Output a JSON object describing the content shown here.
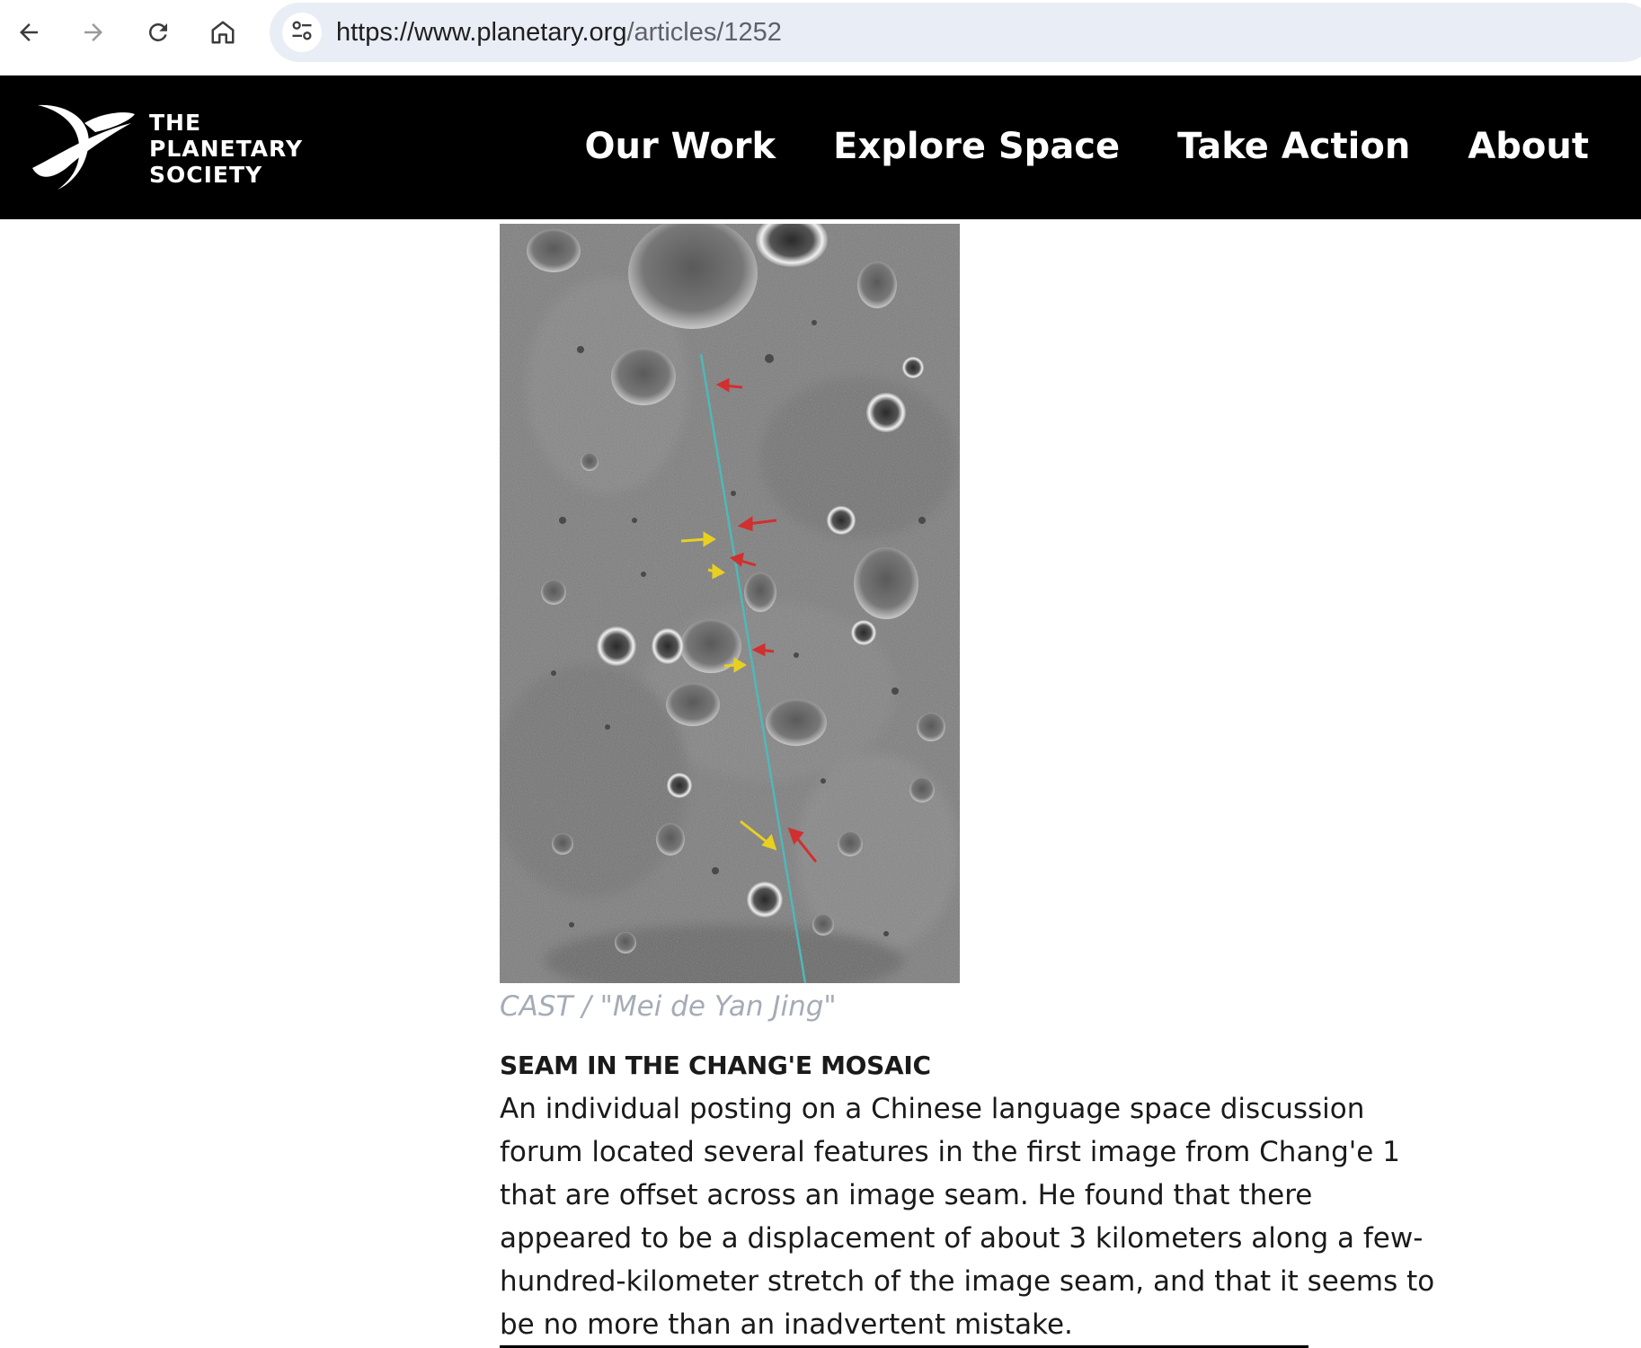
{
  "browser": {
    "url_host": "https://www.planetary.org",
    "url_path": "/articles/1252",
    "back_icon": "arrow-left-icon",
    "forward_icon": "arrow-right-icon",
    "reload_icon": "reload-icon",
    "home_icon": "home-icon",
    "site_info_icon": "tune-icon"
  },
  "header": {
    "logo_lines": [
      "THE",
      "PLANETARY",
      "SOCIETY"
    ],
    "logo_icon": "planetary-society-logo-icon",
    "nav": [
      "Our Work",
      "Explore Space",
      "Take Action",
      "About"
    ],
    "background_color": "#000000",
    "text_color": "#ffffff"
  },
  "article": {
    "figure_alt": "Chang'e 1 lunar image mosaic showing a seam with offset features marked by arrows",
    "caption": "CAST / \"Mei de Yan Jing\"",
    "section_title": "SEAM IN THE CHANG'E MOSAIC",
    "body_lines": [
      "An individual posting on a Chinese language space discussion",
      "forum located several features in the first image from Chang'e 1",
      "that are offset across an image seam. He found that there",
      "appeared to be a displacement of about 3 kilometers along a few-",
      "hundred-kilometer stretch of the image seam, and that it seems to",
      "be no more than an inadvertent mistake."
    ],
    "caption_color": "#a5acb6",
    "seam_color": "#4fb8b8",
    "arrow_colors": {
      "red": "#d0302f",
      "yellow": "#e8d020"
    }
  }
}
